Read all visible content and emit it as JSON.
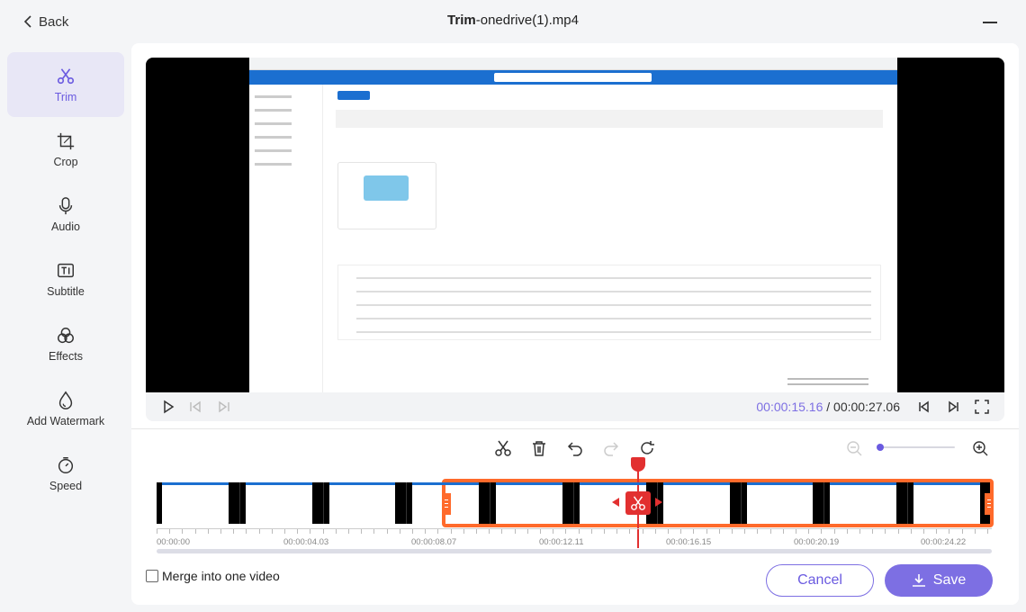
{
  "header": {
    "back_label": "Back",
    "title_prefix": "Trim",
    "title_file": "-onedrive(1).mp4"
  },
  "sidebar": {
    "items": [
      {
        "label": "Trim",
        "icon": "scissors-icon",
        "active": true
      },
      {
        "label": "Crop",
        "icon": "crop-icon"
      },
      {
        "label": "Audio",
        "icon": "microphone-icon"
      },
      {
        "label": "Subtitle",
        "icon": "subtitle-icon"
      },
      {
        "label": "Effects",
        "icon": "effects-icon"
      },
      {
        "label": "Add Watermark",
        "icon": "watermark-icon"
      },
      {
        "label": "Speed",
        "icon": "speed-icon"
      }
    ]
  },
  "player": {
    "current_time": "00:00:15.16",
    "separator": " / ",
    "total_time": "00:00:27.06"
  },
  "timeline": {
    "tick_labels": [
      "00:00:00",
      "00:00:04.03",
      "00:00:08.07",
      "00:00:12.11",
      "00:00:16.15",
      "00:00:20.19",
      "00:00:24.22"
    ],
    "thumbnail_count": 10
  },
  "footer": {
    "merge_label": "Merge into one video",
    "merge_checked": false,
    "cancel_label": "Cancel",
    "save_label": "Save"
  },
  "colors": {
    "accent": "#7d6fe3",
    "selection": "#ff6a2b",
    "playhead": "#e23030"
  }
}
